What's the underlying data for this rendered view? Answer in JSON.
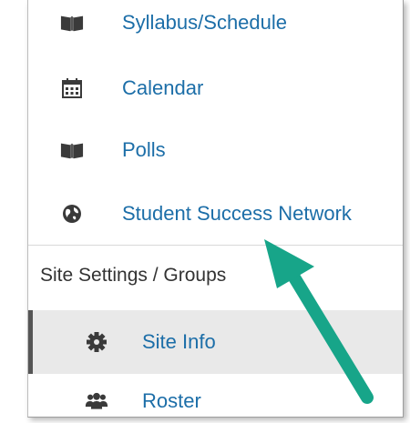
{
  "tools": [
    {
      "label": "Syllabus/Schedule",
      "icon": "book-icon"
    },
    {
      "label": "Calendar",
      "icon": "calendar-icon"
    },
    {
      "label": "Polls",
      "icon": "book-icon"
    },
    {
      "label": "Student Success Network",
      "icon": "globe-icon"
    }
  ],
  "section": {
    "heading": "Site Settings / Groups"
  },
  "sub_items": [
    {
      "label": "Site Info",
      "icon": "gear-icon",
      "active": true
    },
    {
      "label": "Roster",
      "icon": "users-icon",
      "active": false
    }
  ],
  "colors": {
    "link": "#1c6ea8",
    "arrow": "#17a589",
    "active_bg": "#e9e9e9"
  }
}
